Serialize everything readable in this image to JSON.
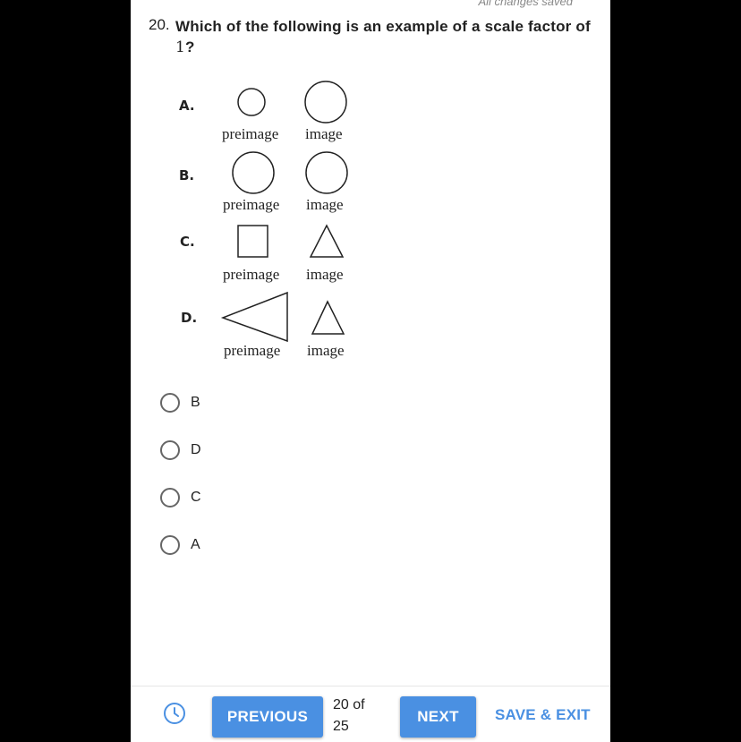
{
  "status": {
    "saved_text": "All changes saved"
  },
  "question": {
    "number": "20.",
    "text_before": "Which of the following is an example of a scale factor of ",
    "text_num": "1",
    "text_after": "?"
  },
  "figure": {
    "rows": [
      {
        "letter": "A.",
        "preimage_shape": "circle",
        "image_shape": "circle",
        "preimage_caption": "preimage",
        "image_caption": "image"
      },
      {
        "letter": "B.",
        "preimage_shape": "circle",
        "image_shape": "circle",
        "preimage_caption": "preimage",
        "image_caption": "image"
      },
      {
        "letter": "C.",
        "preimage_shape": "square",
        "image_shape": "triangle",
        "preimage_caption": "preimage",
        "image_caption": "image"
      },
      {
        "letter": "D.",
        "preimage_shape": "triangle",
        "image_shape": "triangle",
        "preimage_caption": "preimage",
        "image_caption": "image"
      }
    ]
  },
  "choices": [
    {
      "label": "B"
    },
    {
      "label": "D"
    },
    {
      "label": "C"
    },
    {
      "label": "A"
    }
  ],
  "footer": {
    "clock_icon": "clock-icon",
    "previous_label": "PREVIOUS",
    "counter_line1": "20 of",
    "counter_line2": "25",
    "next_label": "NEXT",
    "save_exit_label": "SAVE & EXIT",
    "accent_color": "#4a90e2"
  }
}
